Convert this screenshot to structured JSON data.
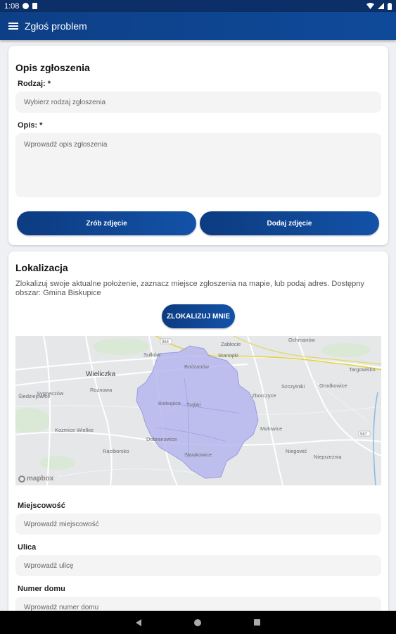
{
  "status_bar": {
    "time": "1:08"
  },
  "app_bar": {
    "title": "Zgłoś problem"
  },
  "description_card": {
    "title": "Opis zgłoszenia",
    "type_label": "Rodzaj: *",
    "type_placeholder": "Wybierz rodzaj zgłoszenia",
    "desc_label": "Opis: *",
    "desc_placeholder": "Wprowadź opis zgłoszenia",
    "take_photo_label": "Zrób zdjęcie",
    "add_photo_label": "Dodaj zdjęcie"
  },
  "location_card": {
    "title": "Lokalizacja",
    "description": "Zlokalizuj swoje aktualne położenie, zaznacz miejsce zgłoszenia na mapie, lub podaj adres. Dostępny obszar: Gmina Biskupice",
    "locate_label": "ZLOKALIZUJ MNIE",
    "map": {
      "attribution": "mapbox",
      "road_badges": [
        "964",
        "967"
      ],
      "labels": [
        "Wieliczka",
        "Sułków",
        "Bodzanów",
        "Staniątki",
        "Zabłocie",
        "Ochmanów",
        "Szczytniki",
        "Targowisko",
        "Śledziejowice",
        "Sygneczów",
        "Rożnowa",
        "Biskupice",
        "Trąbki",
        "Zborczyce",
        "Grodkowice",
        "Kozmice Wielkie",
        "Mułowice",
        "Dobranowice",
        "Raciborsko",
        "Sławkowice",
        "Niegowić",
        "Nieprzeżnia"
      ]
    },
    "city_label": "Miejscowość",
    "city_placeholder": "Wprowadź miejscowość",
    "street_label": "Ulica",
    "street_placeholder": "Wprowadź ulicę",
    "house_label": "Numer domu",
    "house_placeholder": "Wprowadź numer domu"
  }
}
